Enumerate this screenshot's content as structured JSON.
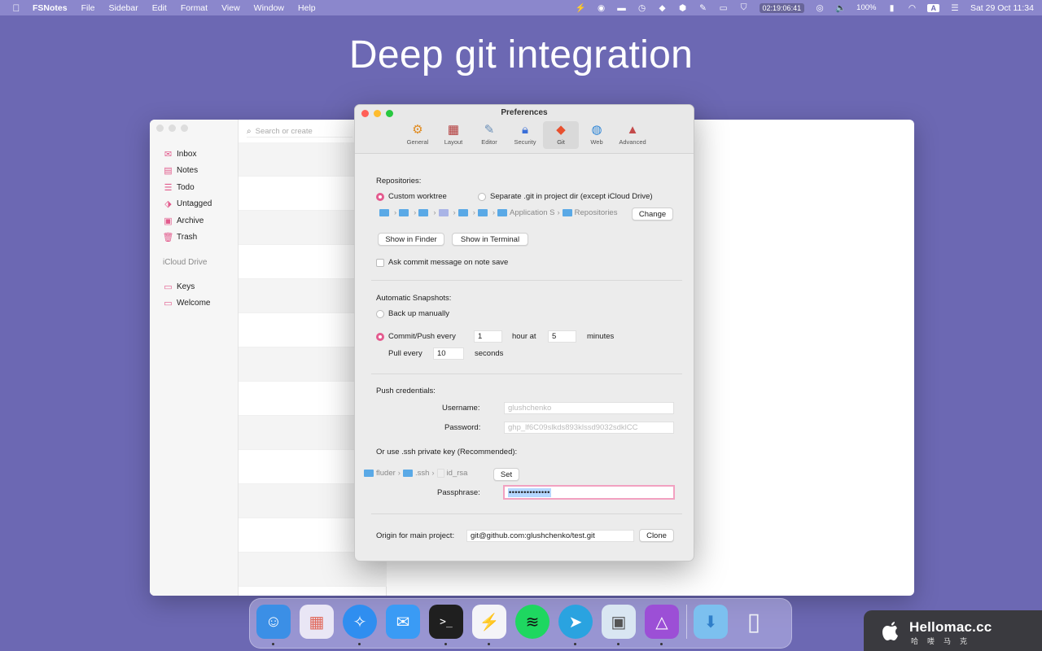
{
  "menubar": {
    "app_name": "FSNotes",
    "menus": [
      "File",
      "Sidebar",
      "Edit",
      "Format",
      "View",
      "Window",
      "Help"
    ],
    "clock_widget": "02:19:06:41",
    "battery": "100%",
    "input_source": "A",
    "datetime": "Sat 29 Oct  11:34"
  },
  "headline": "Deep git integration",
  "main_window": {
    "search_placeholder": "Search or create",
    "sidebar": {
      "items": [
        {
          "label": "Inbox",
          "icon": "inbox-icon"
        },
        {
          "label": "Notes",
          "icon": "notes-icon"
        },
        {
          "label": "Todo",
          "icon": "todo-icon"
        },
        {
          "label": "Untagged",
          "icon": "tag-icon"
        },
        {
          "label": "Archive",
          "icon": "archive-icon"
        },
        {
          "label": "Trash",
          "icon": "trash-icon"
        }
      ],
      "section_title": "iCloud Drive",
      "folders": [
        {
          "label": "Keys",
          "icon": "folder-icon"
        },
        {
          "label": "Welcome",
          "icon": "folder-icon"
        }
      ]
    }
  },
  "preferences": {
    "title": "Preferences",
    "tabs": [
      {
        "label": "General",
        "icon": "gears-icon"
      },
      {
        "label": "Layout",
        "icon": "layout-icon"
      },
      {
        "label": "Editor",
        "icon": "editor-icon"
      },
      {
        "label": "Security",
        "icon": "lock-icon"
      },
      {
        "label": "Git",
        "icon": "git-icon",
        "active": true
      },
      {
        "label": "Web",
        "icon": "globe-icon"
      },
      {
        "label": "Advanced",
        "icon": "rocket-icon"
      }
    ],
    "repositories": {
      "heading": "Repositories:",
      "option_custom": "Custom worktree",
      "option_separate": "Separate .git in project dir (except iCloud Drive)",
      "selected": "custom",
      "path_segments": [
        "Application S",
        "Repositories"
      ],
      "change_label": "Change",
      "show_in_finder": "Show in Finder",
      "show_in_terminal": "Show in Terminal",
      "ask_commit": "Ask commit message on note save"
    },
    "snapshots": {
      "heading": "Automatic Snapshots:",
      "option_manual": "Back up manually",
      "option_commit": "Commit/Push every",
      "selected": "commit",
      "hours_value": "1",
      "hour_at_label": "hour at",
      "minutes_value": "5",
      "minutes_label": "minutes",
      "pull_label": "Pull every",
      "pull_value": "10",
      "seconds_label": "seconds"
    },
    "credentials": {
      "heading": "Push credentials:",
      "username_label": "Username:",
      "username_placeholder": "glushchenko",
      "password_label": "Password:",
      "password_placeholder": "ghp_lf6C09slkds893klssd9032sdklCC",
      "ssh_heading": "Or use .ssh private key (Recommended):",
      "ssh_path": [
        "fluder",
        ".ssh",
        "id_rsa"
      ],
      "set_label": "Set",
      "passphrase_label": "Passphrase:",
      "passphrase_value": "••••••••••••••"
    },
    "origin": {
      "label": "Origin for main project:",
      "value": "git@github.com:glushchenko/test.git",
      "clone_label": "Clone"
    }
  },
  "dock": {
    "apps": [
      {
        "name": "Finder",
        "icon": "finder-icon",
        "color": "#3b8fe6",
        "running": true
      },
      {
        "name": "Launchpad",
        "icon": "launchpad-icon",
        "color": "#e9e6f5",
        "running": false
      },
      {
        "name": "Safari",
        "icon": "safari-icon",
        "color": "#2f8ef0",
        "running": true
      },
      {
        "name": "Mail",
        "icon": "mail-icon",
        "color": "#3a9bf5",
        "running": false
      },
      {
        "name": "Terminal",
        "icon": "terminal-icon",
        "color": "#1f1f1f",
        "running": true
      },
      {
        "name": "FSNotes",
        "icon": "fsnotes-icon",
        "color": "#f4f4f8",
        "running": true
      },
      {
        "name": "Spotify",
        "icon": "spotify-icon",
        "color": "#1ed760",
        "running": false
      },
      {
        "name": "Telegram",
        "icon": "telegram-icon",
        "color": "#2aa3e0",
        "running": true
      },
      {
        "name": "Preview",
        "icon": "preview-icon",
        "color": "#d9e6f2",
        "running": true
      },
      {
        "name": "Affinity Photo",
        "icon": "affinity-icon",
        "color": "#9c4fd6",
        "running": true
      }
    ],
    "downloads_icon": "downloads-folder-icon",
    "trash_icon": "trash-can-icon"
  },
  "watermark": {
    "title": "Hellomac.cc",
    "subtitle": "哈喽马克"
  },
  "colors": {
    "desktop": "#6c68b3",
    "accent": "#e45b8f",
    "sidebar_icon": "#e25a8c"
  }
}
